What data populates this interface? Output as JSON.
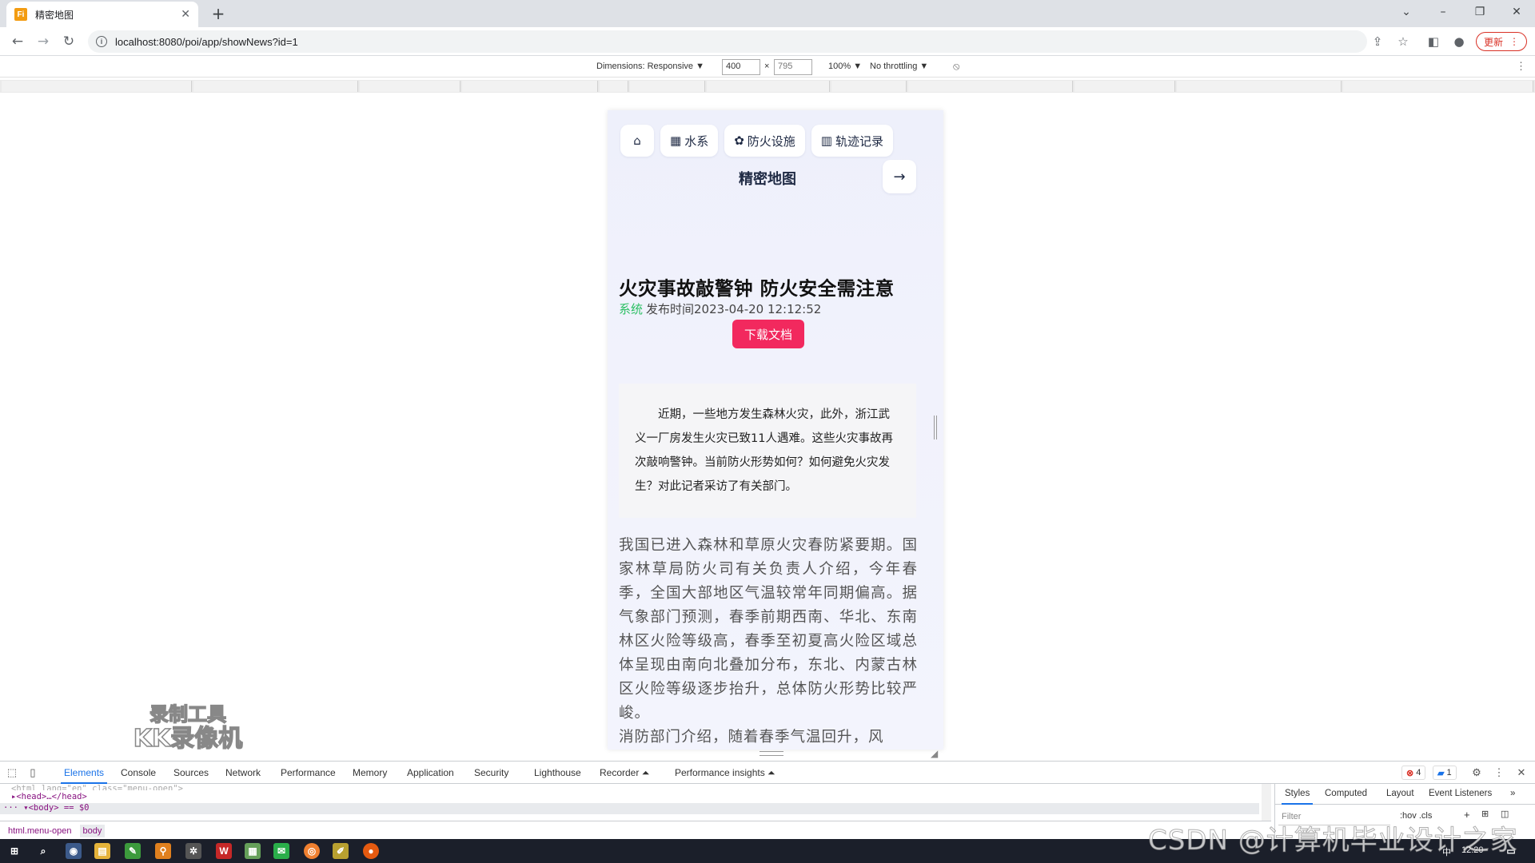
{
  "browser": {
    "tab_title": "精密地图",
    "favicon_letter": "Fi",
    "url": "localhost:8080/poi/app/showNews?id=1",
    "update_label": "更新"
  },
  "device_toolbar": {
    "dimensions_label": "Dimensions: Responsive ▼",
    "width": "400",
    "height": "795",
    "times": "×",
    "zoom": "100% ▼",
    "throttling": "No throttling ▼"
  },
  "app": {
    "nav": [
      {
        "label": "水系",
        "icon": "table-icon"
      },
      {
        "label": "防火设施",
        "icon": "palette-icon"
      },
      {
        "label": "轨迹记录",
        "icon": "map-icon"
      }
    ],
    "brand": "精密地图",
    "article": {
      "title": "火灾事故敲警钟 防火安全需注意",
      "author": "系统",
      "published": "发布时间2023-04-20 12:12:52",
      "download_label": "下载文档",
      "summary": "近期，一些地方发生森林火灾，此外，浙江武义一厂房发生火灾已致11人遇难。这些火灾事故再次敲响警钟。当前防火形势如何？如何避免火灾发生？对此记者采访了有关部门。",
      "body": "我国已进入森林和草原火灾春防紧要期。国家林草局防火司有关负责人介绍，今年春季，全国大部地区气温较常年同期偏高。据气象部门预测，春季前期西南、华北、东南林区火险等级高，春季至初夏高火险区域总体呈现由南向北叠加分布，东北、内蒙古林区火险等级逐步抬升，总体防火形势比较严峻。",
      "body_cut": "消防部门介绍，随着春季气温回升，风"
    }
  },
  "watermark": {
    "line1": "录制工具",
    "line2": "KK录像机"
  },
  "devtools": {
    "tabs": [
      "Elements",
      "Console",
      "Sources",
      "Network",
      "Performance",
      "Memory",
      "Application",
      "Security",
      "Lighthouse",
      "Recorder ⏶",
      "Performance insights ⏶"
    ],
    "errors": "4",
    "messages": "1",
    "dom_lines": [
      "<html lang=\"en\" class=\"menu-open\">",
      "▸<head>…</head>",
      "··· ▾<body> == $0"
    ],
    "breadcrumb": [
      "html.menu-open",
      "body"
    ],
    "styles_tabs": [
      "Styles",
      "Computed",
      "Layout",
      "Event Listeners",
      "»"
    ],
    "filter_placeholder": "Filter",
    "hov_cls": ":hov .cls"
  },
  "taskbar": {
    "time": "12:20",
    "ime": "中",
    "csdn_watermark": "CSDN @计算机毕业设计之家"
  }
}
